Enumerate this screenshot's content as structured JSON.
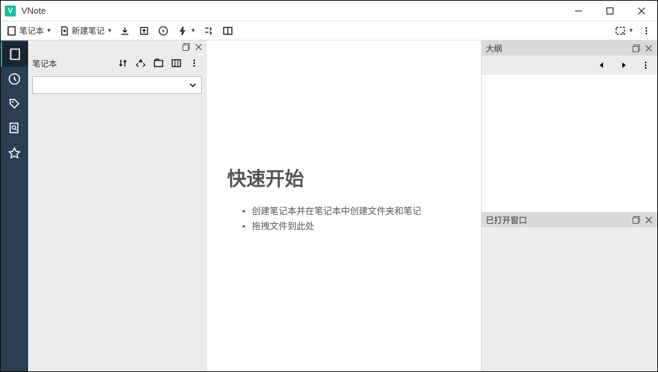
{
  "app": {
    "title": "VNote"
  },
  "toolbar": {
    "notebook_label": "笔记本",
    "new_note_label": "新建笔记"
  },
  "notebook_panel": {
    "title": "笔记本"
  },
  "quickstart": {
    "title": "快速开始",
    "items": [
      "创建笔记本并在笔记本中创建文件夹和笔记",
      "拖拽文件到此处"
    ]
  },
  "right_panel": {
    "outline_title": "大纲",
    "open_windows_title": "已打开窗口"
  }
}
